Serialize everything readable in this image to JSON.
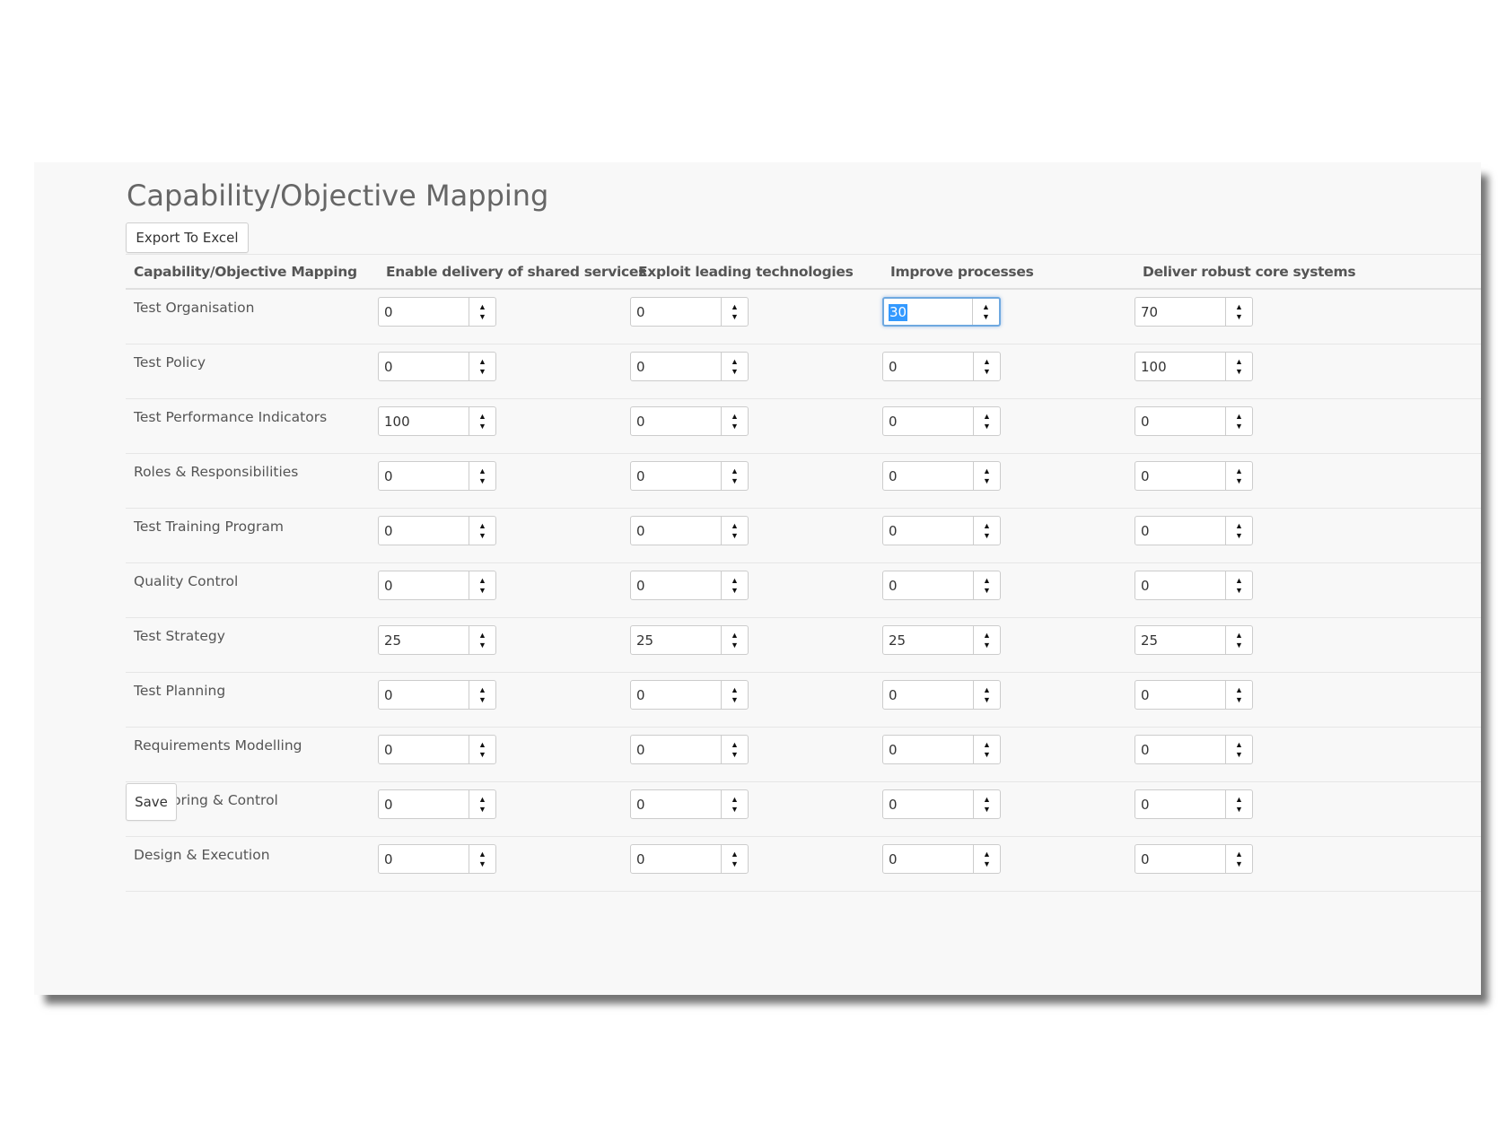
{
  "page": {
    "title": "Capability/Objective Mapping",
    "export_label": "Export To Excel",
    "save_label": "Save"
  },
  "table": {
    "columns": [
      "Capability/Objective Mapping",
      "Enable delivery of shared services",
      "Exploit leading technologies",
      "Improve processes",
      "Deliver robust core systems"
    ],
    "rows": [
      {
        "label": "Test Organisation",
        "values": [
          "0",
          "0",
          "30",
          "70"
        ]
      },
      {
        "label": "Test Policy",
        "values": [
          "0",
          "0",
          "0",
          "100"
        ]
      },
      {
        "label": "Test Performance Indicators",
        "values": [
          "100",
          "0",
          "0",
          "0"
        ]
      },
      {
        "label": "Roles & Responsibilities",
        "values": [
          "0",
          "0",
          "0",
          "0"
        ]
      },
      {
        "label": "Test Training Program",
        "values": [
          "0",
          "0",
          "0",
          "0"
        ]
      },
      {
        "label": "Quality Control",
        "values": [
          "0",
          "0",
          "0",
          "0"
        ]
      },
      {
        "label": "Test Strategy",
        "values": [
          "25",
          "25",
          "25",
          "25"
        ]
      },
      {
        "label": "Test Planning",
        "values": [
          "0",
          "0",
          "0",
          "0"
        ]
      },
      {
        "label": "Requirements Modelling",
        "values": [
          "0",
          "0",
          "0",
          "0"
        ]
      },
      {
        "label": "Monitoring & Control",
        "values": [
          "0",
          "0",
          "0",
          "0"
        ]
      },
      {
        "label": "Design & Execution",
        "values": [
          "0",
          "0",
          "0",
          "0"
        ]
      }
    ],
    "focused_cell": {
      "row": 0,
      "col": 2
    }
  },
  "icons": {
    "spin_up": "triangle-up-icon",
    "spin_down": "triangle-down-icon"
  },
  "colors": {
    "selection": "#3399ff",
    "focus_border": "#6ea8e0",
    "panel_bg": "#f8f8f8"
  }
}
